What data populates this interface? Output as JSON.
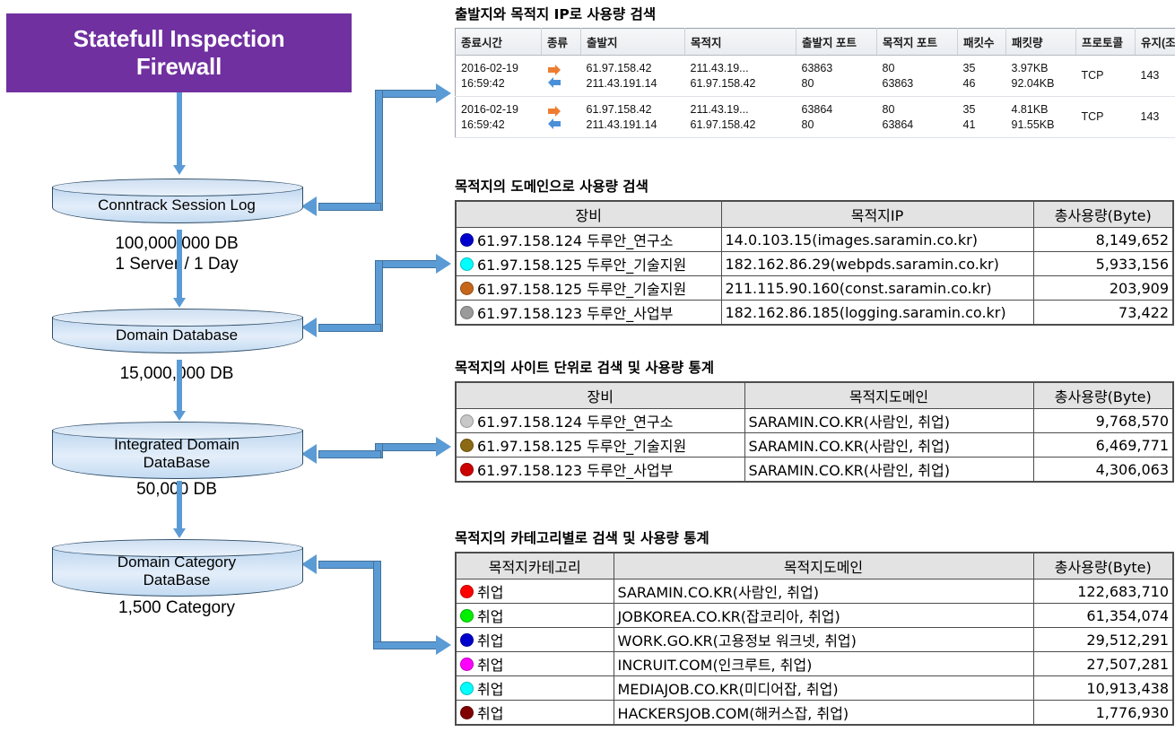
{
  "diagram": {
    "firewall_box": {
      "line1": "Statefull Inspection",
      "line2": "Firewall",
      "color": "#7030A0"
    },
    "nodes": [
      {
        "label_line1": "Conntrack Session Log",
        "label_line2": "",
        "note": "100,000,000 DB\n1 Server / 1 Day"
      },
      {
        "label_line1": "Domain Database",
        "label_line2": "",
        "note": "15,000,000 DB"
      },
      {
        "label_line1": "Integrated Domain",
        "label_line2": "DataBase",
        "note": "50,000 DB"
      },
      {
        "label_line1": "Domain Category",
        "label_line2": "DataBase",
        "note": "1,500 Category"
      }
    ],
    "notes": [
      "100,000,000 DB",
      "1 Server / 1 Day",
      "15,000,000 DB",
      "50,000 DB",
      "1,500 Category"
    ],
    "arrow_color": "#5B9BD5"
  },
  "panels": [
    {
      "title": "출발지와 목적지 IP로 사용량 검색",
      "columns": [
        "종료시간",
        "종류",
        "출발지",
        "목적지",
        "출발지 포트",
        "목적지 포트",
        "패킷수",
        "패킷량",
        "프로토콜",
        "유지(조)"
      ],
      "rows": [
        {
          "time_a": "2016-02-19",
          "time_b": "16:59:42",
          "src_a": "61.97.158.42",
          "src_b": "211.43.191.14",
          "dst_a": "211.43.19...",
          "dst_b": "61.97.158.42",
          "sport_a": "63863",
          "sport_b": "80",
          "dport_a": "80",
          "dport_b": "63863",
          "pkts_a": "35",
          "pkts_b": "46",
          "bytes_a": "3.97KB",
          "bytes_b": "92.04KB",
          "proto": "TCP",
          "keep": "143"
        },
        {
          "time_a": "2016-02-19",
          "time_b": "16:59:42",
          "src_a": "61.97.158.42",
          "src_b": "211.43.191.14",
          "dst_a": "211.43.19...",
          "dst_b": "61.97.158.42",
          "sport_a": "63864",
          "sport_b": "80",
          "dport_a": "80",
          "dport_b": "63864",
          "pkts_a": "35",
          "pkts_b": "41",
          "bytes_a": "4.81KB",
          "bytes_b": "91.55KB",
          "proto": "TCP",
          "keep": "143"
        }
      ]
    },
    {
      "title": "목적지의 도메인으로 사용량 검색",
      "columns": [
        "장비",
        "목적지IP",
        "총사용량(Byte)"
      ],
      "rows": [
        {
          "dot": "#0000CC",
          "device": "61.97.158.124 두루안_연구소",
          "target": "14.0.103.15(images.saramin.co.kr)",
          "total": "8,149,652"
        },
        {
          "dot": "#00FFFF",
          "device": "61.97.158.125 두루안_기술지원",
          "target": "182.162.86.29(webpds.saramin.co.kr)",
          "total": "5,933,156"
        },
        {
          "dot": "#C5661B",
          "device": "61.97.158.125 두루안_기술지원",
          "target": "211.115.90.160(const.saramin.co.kr)",
          "total": "203,909"
        },
        {
          "dot": "#9A9A9A",
          "device": "61.97.158.123 두루안_사업부",
          "target": "182.162.86.185(logging.saramin.co.kr)",
          "total": "73,422"
        }
      ]
    },
    {
      "title": "목적지의 사이트 단위로 검색 및 사용량 통계",
      "columns": [
        "장비",
        "목적지도메인",
        "총사용량(Byte)"
      ],
      "rows": [
        {
          "dot": "#C8C8C8",
          "device": "61.97.158.124 두루안_연구소",
          "target": "SARAMIN.CO.KR(사람인, 취업)",
          "total": "9,768,570"
        },
        {
          "dot": "#8C6A13",
          "device": "61.97.158.125 두루안_기술지원",
          "target": "SARAMIN.CO.KR(사람인, 취업)",
          "total": "6,469,771"
        },
        {
          "dot": "#CC0000",
          "device": "61.97.158.123 두루안_사업부",
          "target": "SARAMIN.CO.KR(사람인, 취업)",
          "total": "4,306,063"
        }
      ]
    },
    {
      "title": "목적지의 카테고리별로 검색 및 사용량 통계",
      "columns": [
        "목적지카테고리",
        "목적지도메인",
        "총사용량(Byte)"
      ],
      "rows": [
        {
          "dot": "#FF0000",
          "category": "취업",
          "target": "SARAMIN.CO.KR(사람인, 취업)",
          "total": "122,683,710"
        },
        {
          "dot": "#00EE00",
          "category": "취업",
          "target": "JOBKOREA.CO.KR(잡코리아, 취업)",
          "total": "61,354,074"
        },
        {
          "dot": "#0000CC",
          "category": "취업",
          "target": "WORK.GO.KR(고용정보 워크넷, 취업)",
          "total": "29,512,291"
        },
        {
          "dot": "#FF00FF",
          "category": "취업",
          "target": "INCRUIT.COM(인크루트, 취업)",
          "total": "27,507,281"
        },
        {
          "dot": "#00FFFF",
          "category": "취업",
          "target": "MEDIAJOB.CO.KR(미디어잡, 취업)",
          "total": "10,913,438"
        },
        {
          "dot": "#800000",
          "category": "취업",
          "target": "HACKERSJOB.COM(해커스잡, 취업)",
          "total": "1,776,930"
        }
      ]
    }
  ]
}
